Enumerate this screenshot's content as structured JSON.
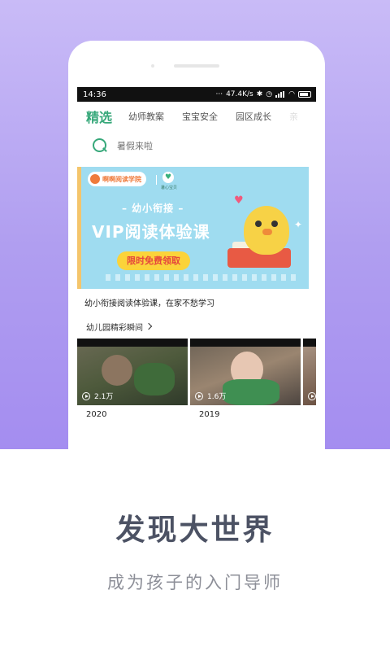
{
  "status_bar": {
    "time": "14:36",
    "network_speed": "47.4K/s",
    "icons": [
      "signal-dots-icon",
      "bluetooth-icon",
      "alarm-icon",
      "signal-icon",
      "wifi-icon",
      "battery-icon"
    ]
  },
  "tabs": [
    {
      "label": "精选",
      "active": true
    },
    {
      "label": "幼师教案"
    },
    {
      "label": "宝宝安全"
    },
    {
      "label": "园区成长"
    },
    {
      "label": "亲"
    }
  ],
  "search": {
    "placeholder": "暑假来啦"
  },
  "banner": {
    "logo_text": "啊啊阅读学院",
    "partner_label": "暑心宝贝",
    "subtitle": "– 幼小衔接 –",
    "title": "VIP阅读体验课",
    "button_label": "限时免费领取",
    "caption": "幼小衔接阅读体验课，在家不愁学习"
  },
  "section": {
    "title": "幼儿园精彩瞬间"
  },
  "videos": [
    {
      "views": "2.1万",
      "year": "2020"
    },
    {
      "views": "1.6万",
      "year": "2019"
    },
    {
      "views": "",
      "year": ""
    }
  ],
  "promo": {
    "headline": "发现大世界",
    "subline": "成为孩子的入门导师"
  },
  "colors": {
    "accent_green": "#37a87a",
    "background_purple": "#b09ef0",
    "banner_blue": "#9fdcf0",
    "button_yellow": "#fbd33a"
  }
}
